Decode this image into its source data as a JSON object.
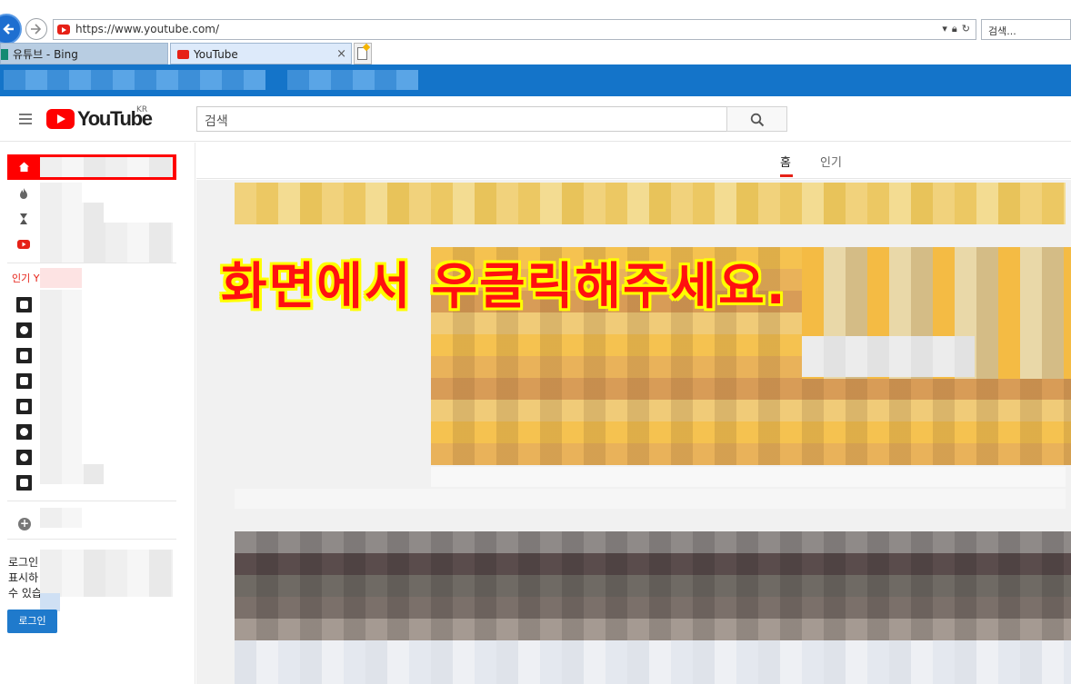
{
  "browser": {
    "url": "https://www.youtube.com/",
    "search_placeholder": "검색...",
    "tabs": [
      {
        "label": "유튜브 - Bing"
      },
      {
        "label": "YouTube",
        "close": "×"
      }
    ]
  },
  "youtube": {
    "logo_text": "YouTube",
    "region": "KR",
    "search_placeholder": "검색",
    "home_tabs": [
      {
        "label": "홈"
      },
      {
        "label": "인기"
      }
    ],
    "sidebar": {
      "section_label": "인기 Y",
      "login_lines": [
        "로그인",
        "표시하",
        "수 있습"
      ],
      "login_button": "로그인"
    }
  },
  "overlay_message": "화면에서  우클릭해주세요.",
  "colors": {
    "youtube_red": "#ff0000",
    "favorites_bar": "#1474c9",
    "login_button": "#1f7acc",
    "overlay_text": "#ff1010",
    "overlay_outline": "#ffff00"
  }
}
